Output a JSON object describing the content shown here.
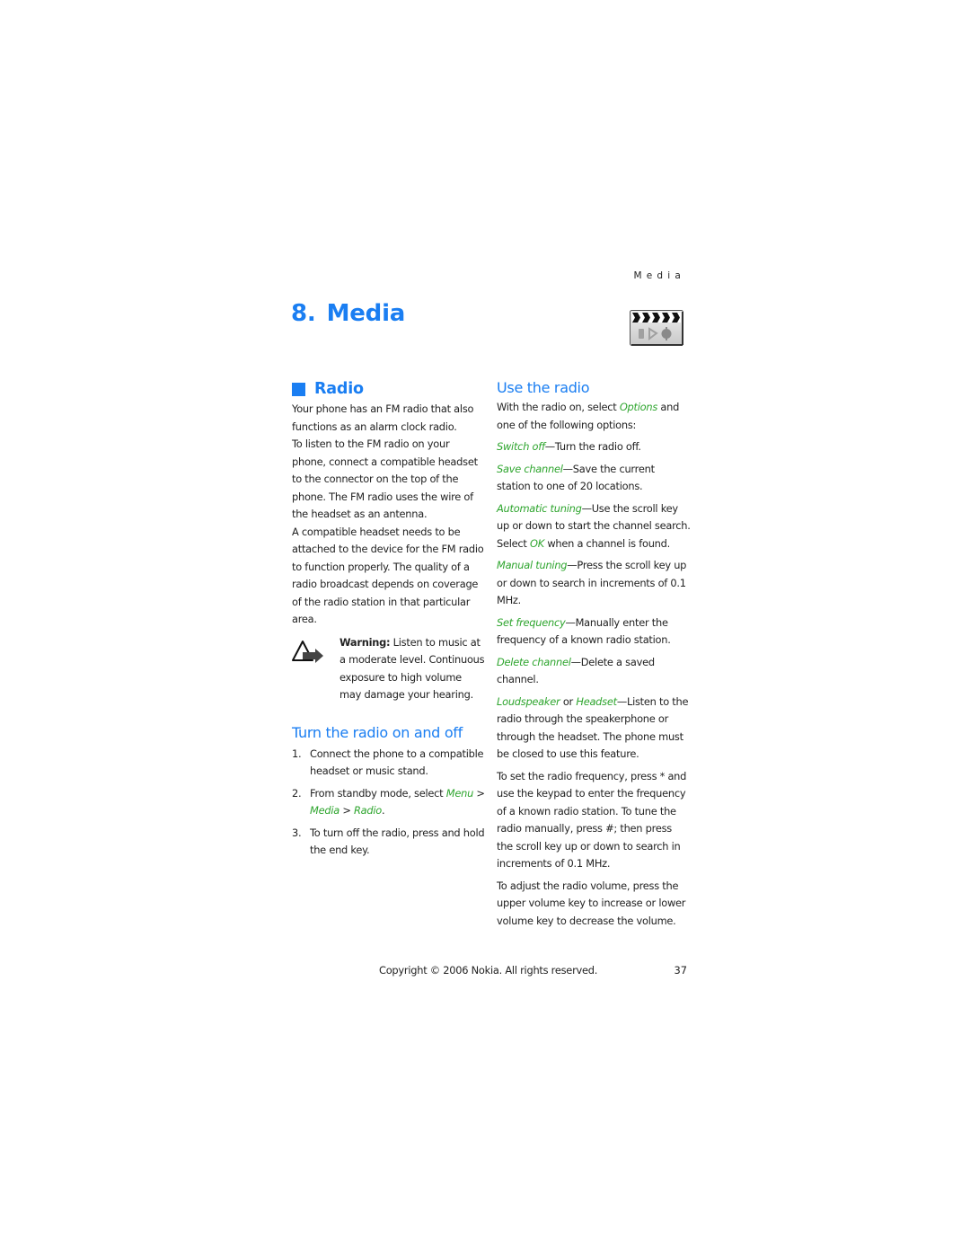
{
  "running_head": "Media",
  "chapter": {
    "number": "8.",
    "title": "Media",
    "icon": "media-clapperboard-icon"
  },
  "radio_section": {
    "heading": "Radio",
    "paragraphs": [
      "Your phone has an FM radio that also functions as an alarm clock radio.",
      "To listen to the FM radio on your phone, connect a compatible headset to the connector on the top of the phone. The FM radio uses the wire of the headset as an antenna.",
      "A compatible headset needs to be attached to the device for the FM radio to function properly. The quality of a radio broadcast depends on coverage of the radio station in that particular area."
    ],
    "warning": {
      "label": "Warning:",
      "text": " Listen to music at a moderate level. Continuous exposure to high volume may damage your hearing.",
      "icon": "warning-icon"
    }
  },
  "turn_on_off": {
    "heading": "Turn the radio on and off",
    "steps": [
      {
        "num": "1.",
        "text": "Connect the phone to a compatible headset or music stand."
      },
      {
        "num": "2.",
        "pre": "From standby mode, select ",
        "menu": "Menu",
        "sep1": " > ",
        "media": "Media",
        "sep2": " > ",
        "radio": "Radio",
        "post": "."
      },
      {
        "num": "3.",
        "text": "To turn off the radio, press and hold the end key."
      }
    ]
  },
  "use_radio": {
    "heading": "Use the radio",
    "intro_pre": "With the radio on, select ",
    "intro_term": "Options",
    "intro_post": " and one of the following options:",
    "options": [
      {
        "term": "Switch off",
        "desc": "—Turn the radio off."
      },
      {
        "term": "Save channel",
        "desc": "—Save the current station to one of 20 locations."
      },
      {
        "term": "Automatic tuning",
        "desc": "—Use the scroll key up or down to start the channel search. Select ",
        "term2": "OK",
        "desc2": " when a channel is found."
      },
      {
        "term": "Manual tuning",
        "desc": "—Press the scroll key up or down to search in increments of 0.1 MHz."
      },
      {
        "term": "Set frequency",
        "desc": "—Manually enter the frequency of a known radio station."
      },
      {
        "term": "Delete channel",
        "desc": "—Delete a saved channel."
      },
      {
        "term": "Loudspeaker",
        "mid": " or ",
        "term2": "Headset",
        "desc": "—Listen to the radio through the speakerphone or through the headset. The phone must be closed to use this feature."
      }
    ],
    "para_frequency": "To set the radio frequency, press * and use the keypad to enter the frequency of a known radio station. To tune the radio manually, press #; then press the scroll key up or down to search in increments of 0.1 MHz.",
    "para_volume": "To adjust the radio volume, press the upper volume key to increase or lower volume key to decrease the volume."
  },
  "footer": {
    "copyright": "Copyright © 2006 Nokia. All rights reserved.",
    "page_number": "37"
  },
  "colors": {
    "heading_blue": "#1a7ef2",
    "term_green": "#2ea52e",
    "body_text": "#222222"
  }
}
